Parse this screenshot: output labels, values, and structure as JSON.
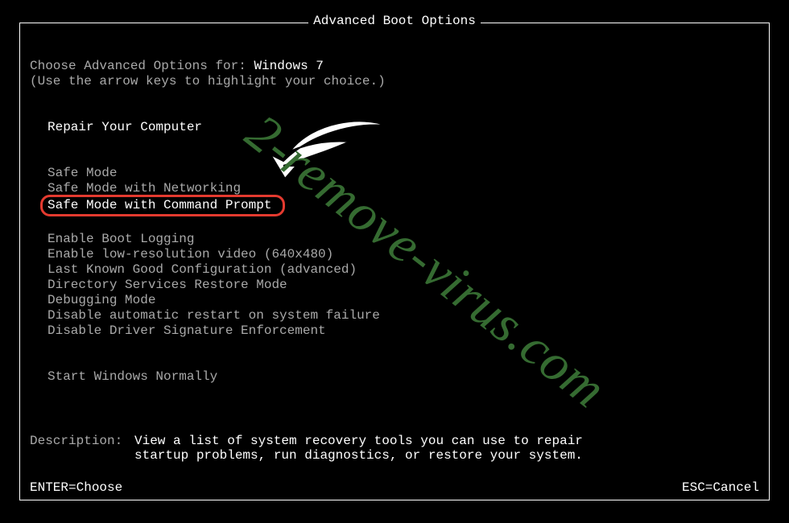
{
  "title": "Advanced Boot Options",
  "instructions": {
    "choose_label": "Choose Advanced Options for:",
    "os_name": "Windows 7",
    "hint": "(Use the arrow keys to highlight your choice.)"
  },
  "menu": {
    "group1": [
      {
        "label": "Repair Your Computer",
        "selected": true,
        "circled": false
      }
    ],
    "group2": [
      {
        "label": "Safe Mode",
        "selected": false,
        "circled": false
      },
      {
        "label": "Safe Mode with Networking",
        "selected": false,
        "circled": false
      },
      {
        "label": "Safe Mode with Command Prompt",
        "selected": false,
        "circled": true
      }
    ],
    "group3": [
      {
        "label": "Enable Boot Logging",
        "selected": false,
        "circled": false
      },
      {
        "label": "Enable low-resolution video (640x480)",
        "selected": false,
        "circled": false
      },
      {
        "label": "Last Known Good Configuration (advanced)",
        "selected": false,
        "circled": false
      },
      {
        "label": "Directory Services Restore Mode",
        "selected": false,
        "circled": false
      },
      {
        "label": "Debugging Mode",
        "selected": false,
        "circled": false
      },
      {
        "label": "Disable automatic restart on system failure",
        "selected": false,
        "circled": false
      },
      {
        "label": "Disable Driver Signature Enforcement",
        "selected": false,
        "circled": false
      }
    ],
    "group4": [
      {
        "label": "Start Windows Normally",
        "selected": false,
        "circled": false
      }
    ]
  },
  "description": {
    "label": "Description:",
    "text": "View a list of system recovery tools you can use to repair startup problems, run diagnostics, or restore your system."
  },
  "statusbar": {
    "left": "ENTER=Choose",
    "right": "ESC=Cancel"
  },
  "watermark": "2-remove-virus.com"
}
